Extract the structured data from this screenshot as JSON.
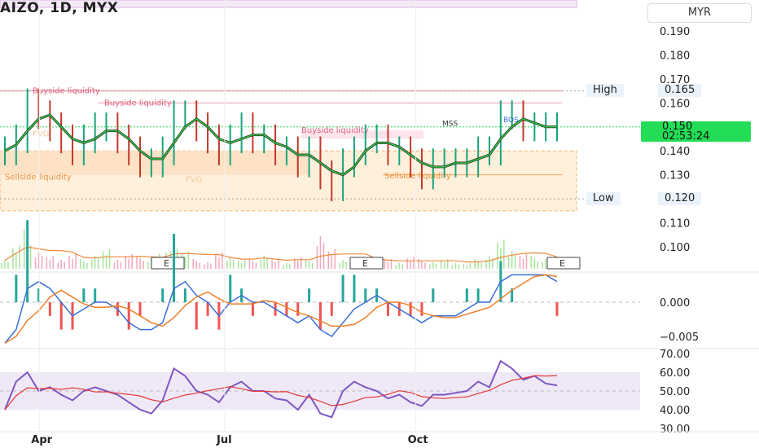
{
  "header": {
    "title": "AIZO, 1D, MYX",
    "currency": "MYR"
  },
  "price_axis": [
    "0.190",
    "0.180",
    "0.170",
    "0.160",
    "0.140",
    "0.130",
    "0.110",
    "0.100"
  ],
  "high": {
    "label": "High",
    "value": "0.165"
  },
  "low": {
    "label": "Low",
    "value": "0.120"
  },
  "last": {
    "price": "0.150",
    "countdown": "02:53:24"
  },
  "macd_axis": [
    "0.000",
    "−0.005"
  ],
  "rsi_axis": [
    "70.00",
    "60.00",
    "50.00",
    "40.00",
    "30.00"
  ],
  "time_axis": [
    "Apr",
    "Jul",
    "Oct"
  ],
  "annotations": {
    "buyside1": "Buyside liquidity",
    "buyside2": "Buyside liquidity",
    "buyside3": "Buyside liquidity",
    "sellside1": "Sellside liquidity",
    "sellside2": "Sellside liquidity",
    "fvg1": "FVG",
    "fvg2": "FVG",
    "mss": "MSS",
    "bos": "BOS",
    "earn": "E"
  },
  "colors": {
    "up": "#1aa37a",
    "down": "#c0392b",
    "macd": "#3a6fd8",
    "signal": "#f07f2a",
    "rsi": "#7e57c2",
    "last": "#22dd55"
  },
  "chart_data": {
    "type": "line",
    "title": "AIZO, 1D, MYX",
    "price_range": [
      0.085,
      0.195
    ],
    "price_ticks": [
      0.19,
      0.18,
      0.17,
      0.16,
      0.15,
      0.14,
      0.13,
      0.12,
      0.11,
      0.1
    ],
    "high": 0.165,
    "low": 0.12,
    "last": 0.15,
    "months": [
      {
        "label": "Apr",
        "x_frac": 0.07
      },
      {
        "label": "Jul",
        "x_frac": 0.4
      },
      {
        "label": "Oct",
        "x_frac": 0.74
      }
    ],
    "close": [
      0.14,
      0.145,
      0.16,
      0.155,
      0.15,
      0.145,
      0.14,
      0.145,
      0.15,
      0.15,
      0.145,
      0.14,
      0.135,
      0.135,
      0.14,
      0.155,
      0.155,
      0.15,
      0.145,
      0.14,
      0.145,
      0.15,
      0.145,
      0.145,
      0.14,
      0.14,
      0.135,
      0.14,
      0.13,
      0.125,
      0.135,
      0.14,
      0.145,
      0.145,
      0.14,
      0.14,
      0.135,
      0.13,
      0.135,
      0.135,
      0.135,
      0.135,
      0.14,
      0.14,
      0.155,
      0.155,
      0.15,
      0.15,
      0.15,
      0.15
    ],
    "macd": [
      -0.006,
      -0.004,
      0.002,
      0.003,
      0.002,
      0.0,
      -0.002,
      -0.001,
      0.0,
      0.0,
      -0.001,
      -0.003,
      -0.004,
      -0.004,
      -0.003,
      0.002,
      0.003,
      0.001,
      0.0,
      -0.002,
      0.0,
      0.001,
      0.0,
      0.0,
      -0.001,
      -0.002,
      -0.003,
      -0.002,
      -0.004,
      -0.005,
      -0.003,
      -0.001,
      0.0,
      0.001,
      0.0,
      -0.001,
      -0.002,
      -0.003,
      -0.002,
      -0.002,
      -0.002,
      -0.001,
      0.0,
      0.0,
      0.003,
      0.004,
      0.004,
      0.004,
      0.004,
      0.003
    ],
    "macd_range": [
      -0.008,
      0.005
    ],
    "rsi": [
      40,
      55,
      60,
      50,
      52,
      48,
      45,
      50,
      52,
      50,
      48,
      44,
      40,
      38,
      45,
      62,
      58,
      50,
      48,
      44,
      52,
      55,
      50,
      50,
      46,
      45,
      40,
      48,
      38,
      36,
      50,
      55,
      52,
      50,
      46,
      48,
      44,
      42,
      48,
      48,
      49,
      50,
      55,
      52,
      66,
      62,
      56,
      58,
      54,
      53
    ],
    "rsi_range": [
      30,
      72
    ],
    "rsi_band": [
      40,
      60
    ],
    "volume": [
      3,
      8,
      12,
      5,
      4,
      3,
      5,
      3,
      4,
      6,
      3,
      5,
      4,
      3,
      5,
      9,
      6,
      3,
      2,
      5,
      4,
      3,
      3,
      4,
      3,
      2,
      4,
      3,
      10,
      6,
      3,
      4,
      3,
      2,
      3,
      2,
      4,
      3,
      2,
      3,
      2,
      2,
      3,
      4,
      9,
      6,
      5,
      4,
      3,
      3
    ]
  }
}
